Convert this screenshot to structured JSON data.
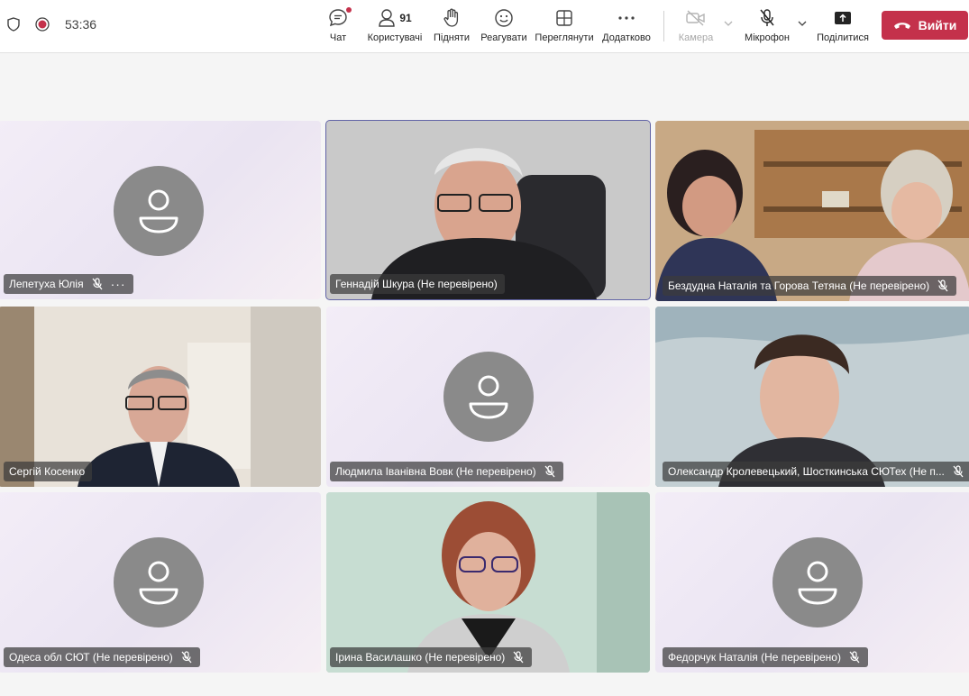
{
  "toolbar": {
    "timer": "53:36",
    "chat_label": "Чат",
    "people_label": "Користувачі",
    "people_count": "91",
    "raise_label": "Підняти",
    "react_label": "Реагувати",
    "view_label": "Переглянути",
    "more_label": "Додатково",
    "camera_label": "Камера",
    "mic_label": "Мікрофон",
    "share_label": "Поділитися",
    "leave_label": "Вийти"
  },
  "participants": [
    {
      "name": "Лепетуха Юлія",
      "video": false,
      "muted": true
    },
    {
      "name": "Геннадій Шкура (Не перевірено)",
      "video": true,
      "muted": false
    },
    {
      "name": "Бездудна Наталія та Горова Тетяна (Не перевірено)",
      "video": true,
      "muted": true
    },
    {
      "name": "Сергій Косенко",
      "video": true,
      "muted": false
    },
    {
      "name": "Людмила Іванівна Вовк (Не перевірено)",
      "video": false,
      "muted": true
    },
    {
      "name": "Олександр Кролевецький, Шосткинська СЮТех (Не п...",
      "video": true,
      "muted": true
    },
    {
      "name": "Одеса обл СЮТ (Не перевірено)",
      "video": false,
      "muted": true
    },
    {
      "name": "Ірина Василашко (Не перевірено)",
      "video": true,
      "muted": true
    },
    {
      "name": "Федорчук Наталія (Не перевірено)",
      "video": false,
      "muted": true
    }
  ],
  "colors": {
    "leave": "#c4314b",
    "active_outline": "#6264a7",
    "avatar": "#8a8a8a"
  }
}
